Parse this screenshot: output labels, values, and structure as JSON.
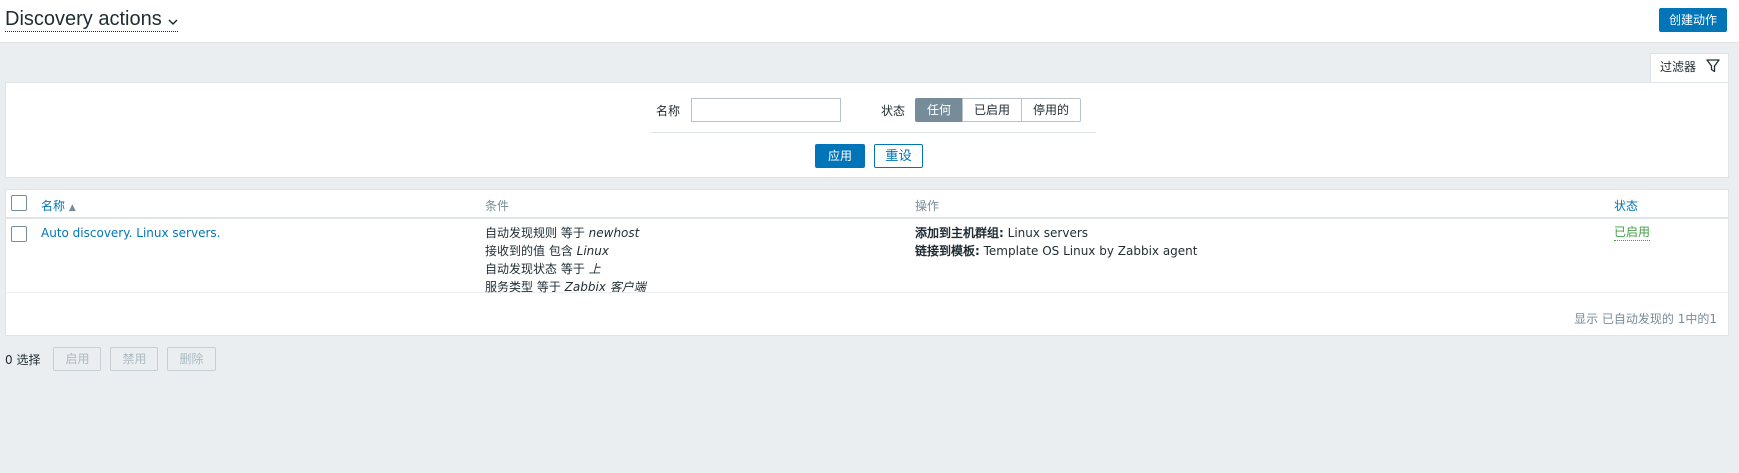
{
  "header": {
    "title": "Discovery actions",
    "create_button": "创建动作"
  },
  "filter": {
    "tab_label": "过滤器",
    "name_label": "名称",
    "name_value": "",
    "status_label": "状态",
    "status_options": [
      "任何",
      "已启用",
      "停用的"
    ],
    "status_selected": "任何",
    "apply_label": "应用",
    "reset_label": "重设"
  },
  "table": {
    "columns": {
      "name": "名称",
      "conditions": "条件",
      "operations": "操作",
      "status": "状态"
    },
    "sort_indicator": "▲",
    "rows": [
      {
        "name": "Auto discovery. Linux servers.",
        "conditions": [
          {
            "label": "自动发现规则 等于 ",
            "value": "newhost"
          },
          {
            "label": "接收到的值 包含 ",
            "value": "Linux"
          },
          {
            "label": "自动发现状态 等于 ",
            "value": "上"
          },
          {
            "label": "服务类型 等于 ",
            "value": "Zabbix 客户端"
          }
        ],
        "operations": [
          {
            "label": "添加到主机群组:",
            "value": " Linux servers"
          },
          {
            "label": "链接到模板:",
            "value": " Template OS Linux by Zabbix agent"
          }
        ],
        "status": "已启用"
      }
    ],
    "footer_count": "显示 已自动发现的 1中的1"
  },
  "bottom": {
    "selected_count": "0 选择",
    "buttons": [
      "启用",
      "禁用",
      "删除"
    ]
  },
  "colors": {
    "primary": "#0275b8",
    "enabled": "#429e47",
    "background": "#ebeef0"
  }
}
